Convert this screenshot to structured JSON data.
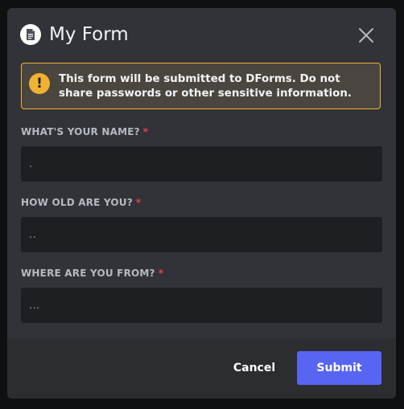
{
  "modal": {
    "title": "My Form",
    "app_icon": "document-icon",
    "close_icon": "close-icon"
  },
  "notice": {
    "icon": "warning-icon",
    "icon_glyph": "!",
    "text_pre": "This form will be submitted to ",
    "text_bold": "DForms",
    "text_post": ". Do not share passwords or other sensitive information."
  },
  "fields": [
    {
      "label": "WHAT'S YOUR NAME?",
      "required_mark": "*",
      "placeholder": ".",
      "value": ""
    },
    {
      "label": "HOW OLD ARE YOU?",
      "required_mark": "*",
      "placeholder": "..",
      "value": ""
    },
    {
      "label": "WHERE ARE YOU FROM?",
      "required_mark": "*",
      "placeholder": "...",
      "value": ""
    }
  ],
  "footer": {
    "cancel_label": "Cancel",
    "submit_label": "Submit"
  },
  "colors": {
    "accent": "#5865f2",
    "warning": "#f0b232",
    "required": "#f23f43",
    "modal_bg": "#313338",
    "footer_bg": "#2b2d31",
    "input_bg": "#1e1f22"
  }
}
